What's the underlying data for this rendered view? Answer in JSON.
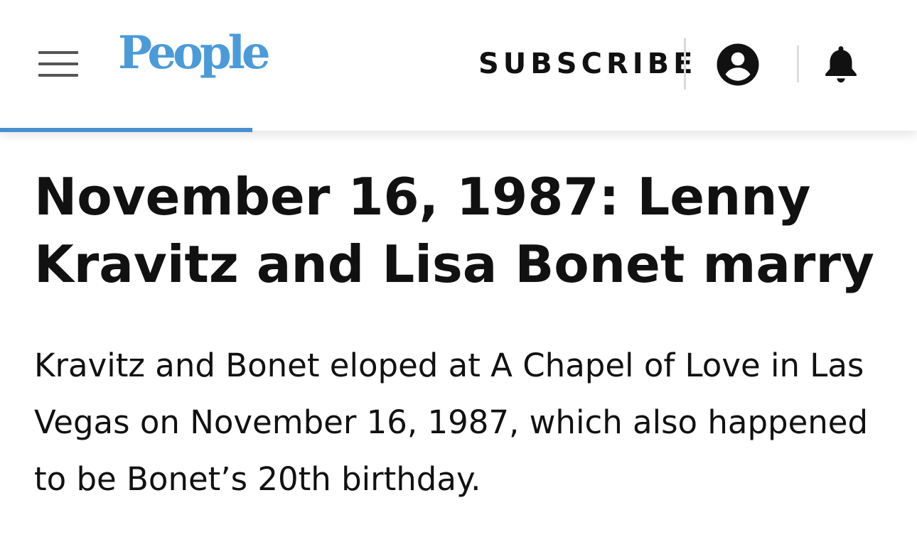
{
  "header": {
    "menu_icon": "hamburger-menu-icon",
    "logo_text": "People",
    "subscribe_label": "SUBSCRIBE",
    "account_icon": "account-circle-icon",
    "notifications_icon": "bell-icon",
    "colors": {
      "logo": "#4b9bd9",
      "progress": "#4a90d0"
    }
  },
  "reading_progress": 0.275,
  "article": {
    "headline": "November 16, 1987: Lenny Kravitz and Lisa Bonet marry",
    "body": "Kravitz and Bonet eloped at A Chapel of Love in Las Vegas on November 16, 1987, which also happened to be Bonet’s 20th birthday."
  }
}
